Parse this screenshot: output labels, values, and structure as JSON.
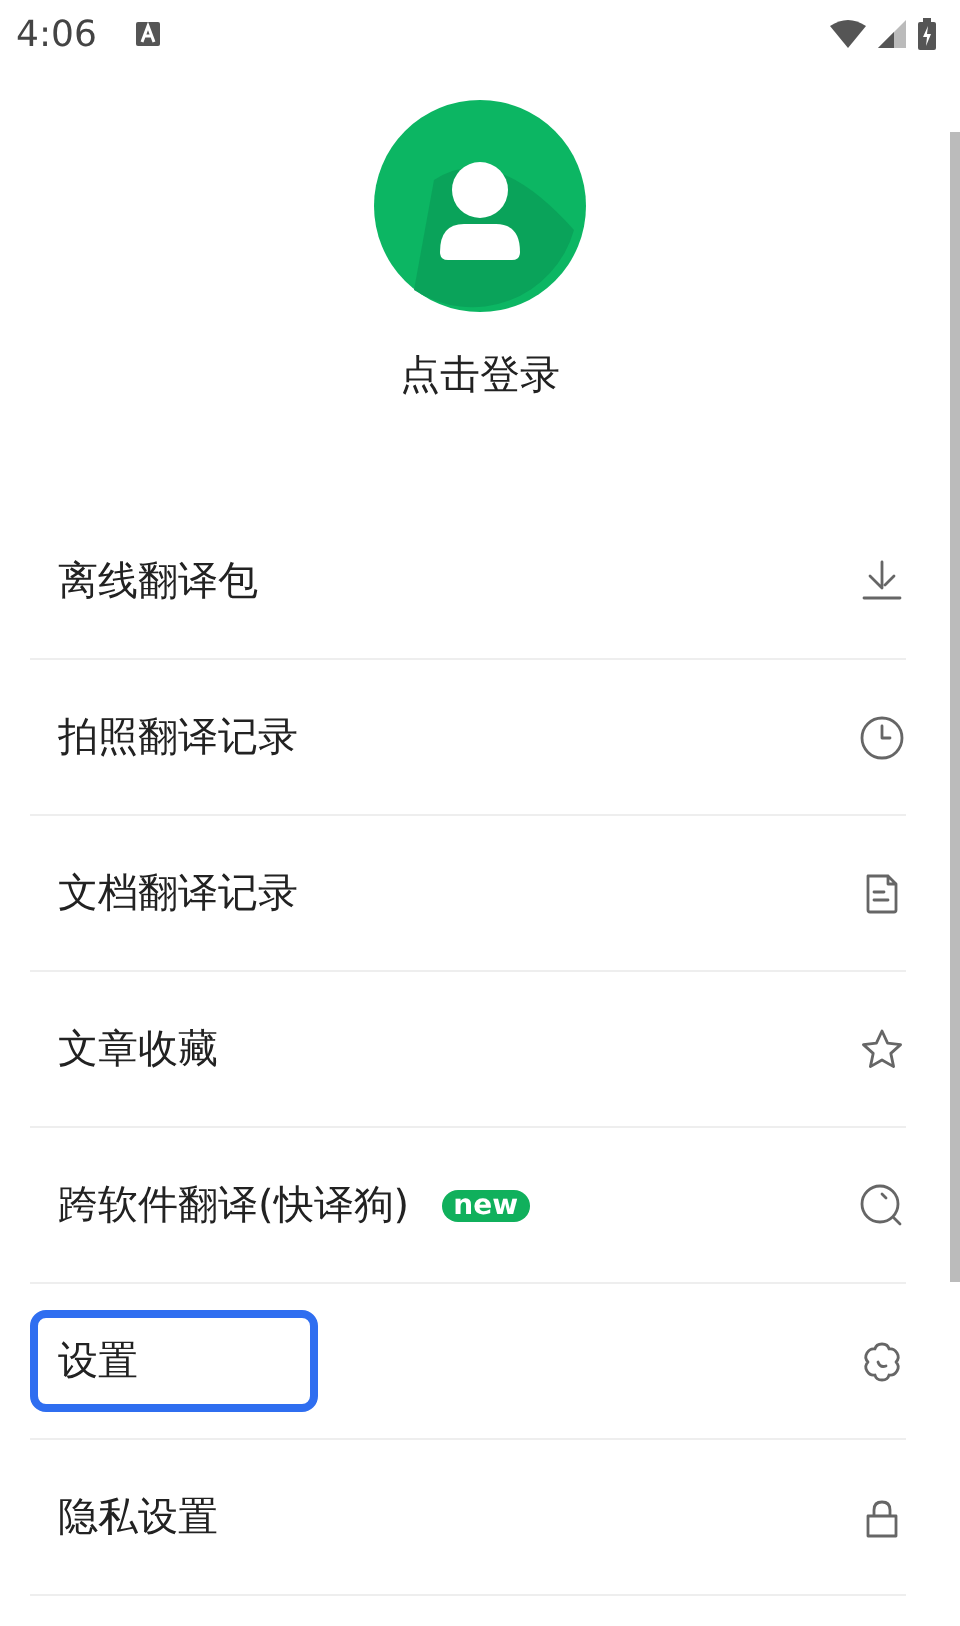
{
  "status_bar": {
    "time": "4:06"
  },
  "profile": {
    "login_label": "点击登录"
  },
  "menu": [
    {
      "label": "离线翻译包",
      "kind": "download",
      "highlighted": false
    },
    {
      "label": "拍照翻译记录",
      "kind": "clock",
      "highlighted": false
    },
    {
      "label": "文档翻译记录",
      "kind": "document",
      "highlighted": false
    },
    {
      "label": "文章收藏",
      "kind": "star",
      "highlighted": false
    },
    {
      "label": "跨软件翻译(快译狗)",
      "badge": "new",
      "kind": "search",
      "highlighted": false
    },
    {
      "label": "设置",
      "kind": "gear",
      "highlighted": true
    },
    {
      "label": "隐私设置",
      "kind": "lock",
      "highlighted": false
    }
  ]
}
